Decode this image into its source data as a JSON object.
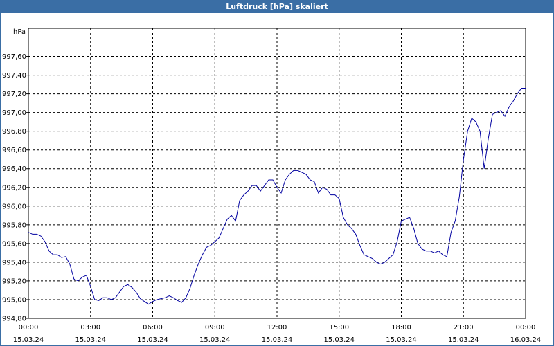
{
  "window": {
    "title": "Luftdruck [hPa] skaliert"
  },
  "colors": {
    "titlebar": "#3a6ea5",
    "line": "#0000a0",
    "grid": "#000000"
  },
  "chart_data": {
    "type": "line",
    "title": "Luftdruck [hPa] skaliert",
    "ylabel": "hPa",
    "xlabel": "",
    "grid": true,
    "ylim": [
      994.8,
      997.9
    ],
    "xlim": [
      0,
      24
    ],
    "y_ticks": [
      "994,80",
      "995,00",
      "995,20",
      "995,40",
      "995,60",
      "995,80",
      "996,00",
      "996,20",
      "996,40",
      "996,60",
      "996,80",
      "997,00",
      "997,20",
      "997,40",
      "997,60"
    ],
    "y_tick_values": [
      994.8,
      995.0,
      995.2,
      995.4,
      995.6,
      995.8,
      996.0,
      996.2,
      996.4,
      996.6,
      996.8,
      997.0,
      997.2,
      997.4,
      997.6
    ],
    "x_ticks": [
      {
        "time": "00:00",
        "date": "15.03.24",
        "hour": 0
      },
      {
        "time": "03:00",
        "date": "15.03.24",
        "hour": 3
      },
      {
        "time": "06:00",
        "date": "15.03.24",
        "hour": 6
      },
      {
        "time": "09:00",
        "date": "15.03.24",
        "hour": 9
      },
      {
        "time": "12:00",
        "date": "15.03.24",
        "hour": 12
      },
      {
        "time": "15:00",
        "date": "15.03.24",
        "hour": 15
      },
      {
        "time": "18:00",
        "date": "15.03.24",
        "hour": 18
      },
      {
        "time": "21:00",
        "date": "15.03.24",
        "hour": 21
      },
      {
        "time": "00:00",
        "date": "16.03.24",
        "hour": 24
      }
    ],
    "series": [
      {
        "points": [
          [
            0.0,
            995.72
          ],
          [
            0.2,
            995.7
          ],
          [
            0.4,
            995.7
          ],
          [
            0.6,
            995.68
          ],
          [
            0.8,
            995.62
          ],
          [
            1.0,
            995.52
          ],
          [
            1.2,
            995.48
          ],
          [
            1.4,
            995.48
          ],
          [
            1.6,
            995.45
          ],
          [
            1.8,
            995.46
          ],
          [
            2.0,
            995.38
          ],
          [
            2.2,
            995.22
          ],
          [
            2.4,
            995.2
          ],
          [
            2.6,
            995.24
          ],
          [
            2.8,
            995.26
          ],
          [
            3.0,
            995.14
          ],
          [
            3.2,
            995.0
          ],
          [
            3.4,
            994.99
          ],
          [
            3.6,
            995.02
          ],
          [
            3.8,
            995.02
          ],
          [
            4.0,
            995.0
          ],
          [
            4.2,
            995.02
          ],
          [
            4.4,
            995.08
          ],
          [
            4.6,
            995.14
          ],
          [
            4.8,
            995.16
          ],
          [
            5.0,
            995.13
          ],
          [
            5.2,
            995.08
          ],
          [
            5.4,
            995.01
          ],
          [
            5.6,
            994.98
          ],
          [
            5.8,
            994.95
          ],
          [
            6.0,
            994.98
          ],
          [
            6.2,
            995.0
          ],
          [
            6.4,
            995.01
          ],
          [
            6.6,
            995.02
          ],
          [
            6.8,
            995.04
          ],
          [
            7.0,
            995.02
          ],
          [
            7.2,
            994.99
          ],
          [
            7.4,
            994.97
          ],
          [
            7.6,
            995.02
          ],
          [
            7.8,
            995.12
          ],
          [
            8.0,
            995.26
          ],
          [
            8.2,
            995.38
          ],
          [
            8.4,
            995.48
          ],
          [
            8.6,
            995.56
          ],
          [
            8.8,
            995.58
          ],
          [
            9.0,
            995.62
          ],
          [
            9.2,
            995.66
          ],
          [
            9.4,
            995.76
          ],
          [
            9.6,
            995.86
          ],
          [
            9.8,
            995.9
          ],
          [
            10.0,
            995.84
          ],
          [
            10.2,
            996.06
          ],
          [
            10.4,
            996.12
          ],
          [
            10.6,
            996.16
          ],
          [
            10.8,
            996.22
          ],
          [
            11.0,
            996.22
          ],
          [
            11.2,
            996.16
          ],
          [
            11.4,
            996.22
          ],
          [
            11.6,
            996.28
          ],
          [
            11.8,
            996.28
          ],
          [
            12.0,
            996.2
          ],
          [
            12.2,
            996.14
          ],
          [
            12.4,
            996.28
          ],
          [
            12.6,
            996.34
          ],
          [
            12.8,
            996.38
          ],
          [
            13.0,
            996.38
          ],
          [
            13.2,
            996.36
          ],
          [
            13.4,
            996.34
          ],
          [
            13.6,
            996.28
          ],
          [
            13.8,
            996.26
          ],
          [
            14.0,
            996.14
          ],
          [
            14.2,
            996.2
          ],
          [
            14.4,
            996.18
          ],
          [
            14.6,
            996.12
          ],
          [
            14.8,
            996.12
          ],
          [
            15.0,
            996.08
          ],
          [
            15.2,
            995.88
          ],
          [
            15.4,
            995.8
          ],
          [
            15.6,
            995.76
          ],
          [
            15.8,
            995.7
          ],
          [
            16.0,
            995.58
          ],
          [
            16.2,
            995.48
          ],
          [
            16.4,
            995.46
          ],
          [
            16.6,
            995.44
          ],
          [
            16.8,
            995.4
          ],
          [
            17.0,
            995.38
          ],
          [
            17.2,
            995.4
          ],
          [
            17.4,
            995.44
          ],
          [
            17.6,
            995.48
          ],
          [
            17.8,
            995.62
          ],
          [
            18.0,
            995.84
          ],
          [
            18.2,
            995.86
          ],
          [
            18.4,
            995.88
          ],
          [
            18.6,
            995.76
          ],
          [
            18.8,
            995.6
          ],
          [
            19.0,
            995.54
          ],
          [
            19.2,
            995.52
          ],
          [
            19.4,
            995.52
          ],
          [
            19.6,
            995.5
          ],
          [
            19.8,
            995.52
          ],
          [
            20.0,
            995.48
          ],
          [
            20.2,
            995.46
          ],
          [
            20.4,
            995.72
          ],
          [
            20.6,
            995.84
          ],
          [
            20.8,
            996.1
          ],
          [
            21.0,
            996.5
          ],
          [
            21.2,
            996.8
          ],
          [
            21.4,
            996.94
          ],
          [
            21.6,
            996.9
          ],
          [
            21.8,
            996.8
          ],
          [
            22.0,
            996.4
          ],
          [
            22.2,
            996.72
          ],
          [
            22.4,
            996.98
          ],
          [
            22.6,
            997.0
          ],
          [
            22.8,
            997.02
          ],
          [
            23.0,
            996.96
          ],
          [
            23.2,
            997.06
          ],
          [
            23.4,
            997.12
          ],
          [
            23.6,
            997.2
          ],
          [
            23.8,
            997.26
          ],
          [
            24.0,
            997.26
          ]
        ]
      }
    ]
  }
}
